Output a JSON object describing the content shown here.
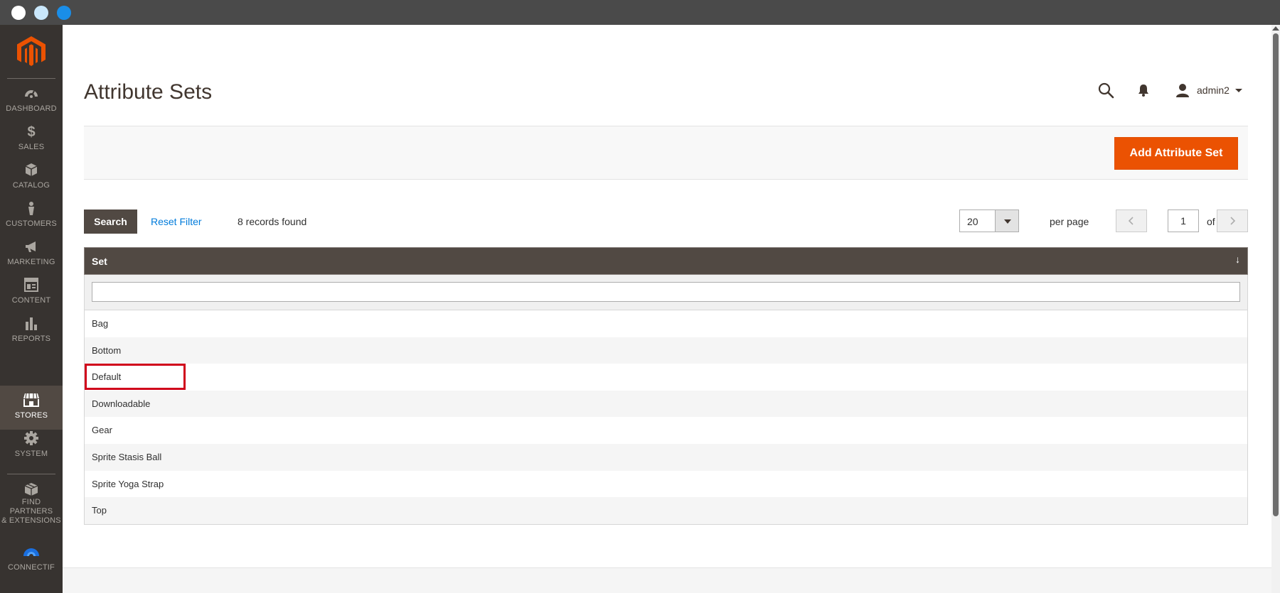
{
  "colors": {
    "accent": "#eb5202",
    "sidebar_bg": "#373330",
    "sidebar_active": "#514943",
    "link": "#007bdb",
    "highlight_border": "#d0021b"
  },
  "sidebar": {
    "logo": "magento-logo",
    "items": [
      {
        "label": "DASHBOARD",
        "icon": "dashboard-icon"
      },
      {
        "label": "SALES",
        "icon": "dollar-icon"
      },
      {
        "label": "CATALOG",
        "icon": "cube-icon"
      },
      {
        "label": "CUSTOMERS",
        "icon": "person-icon"
      },
      {
        "label": "MARKETING",
        "icon": "megaphone-icon"
      },
      {
        "label": "CONTENT",
        "icon": "layout-icon"
      },
      {
        "label": "REPORTS",
        "icon": "bar-chart-icon"
      },
      {
        "label": "STORES",
        "icon": "storefront-icon",
        "active": true
      },
      {
        "label": "SYSTEM",
        "icon": "gear-icon"
      },
      {
        "label": "FIND PARTNERS & EXTENSIONS",
        "label_line1": "FIND PARTNERS",
        "label_line2": "& EXTENSIONS",
        "icon": "extensions-box-icon"
      },
      {
        "label": "CONNECTIF",
        "icon": "connectif-icon"
      }
    ]
  },
  "header": {
    "title": "Attribute Sets",
    "user_name": "admin2"
  },
  "actions": {
    "add_label": "Add Attribute Set"
  },
  "grid_tools": {
    "search_label": "Search",
    "reset_label": "Reset Filter",
    "records_text": "8 records found",
    "per_page_value": "20",
    "per_page_label": "per page",
    "current_page": "1",
    "of_pages": "of 1"
  },
  "grid": {
    "column_header": "Set",
    "sort_indicator": "↓",
    "filter_value": "",
    "rows": [
      "Bag",
      "Bottom",
      "Default",
      "Downloadable",
      "Gear",
      "Sprite Stasis Ball",
      "Sprite Yoga Strap",
      "Top"
    ],
    "highlighted_row": "Default"
  }
}
